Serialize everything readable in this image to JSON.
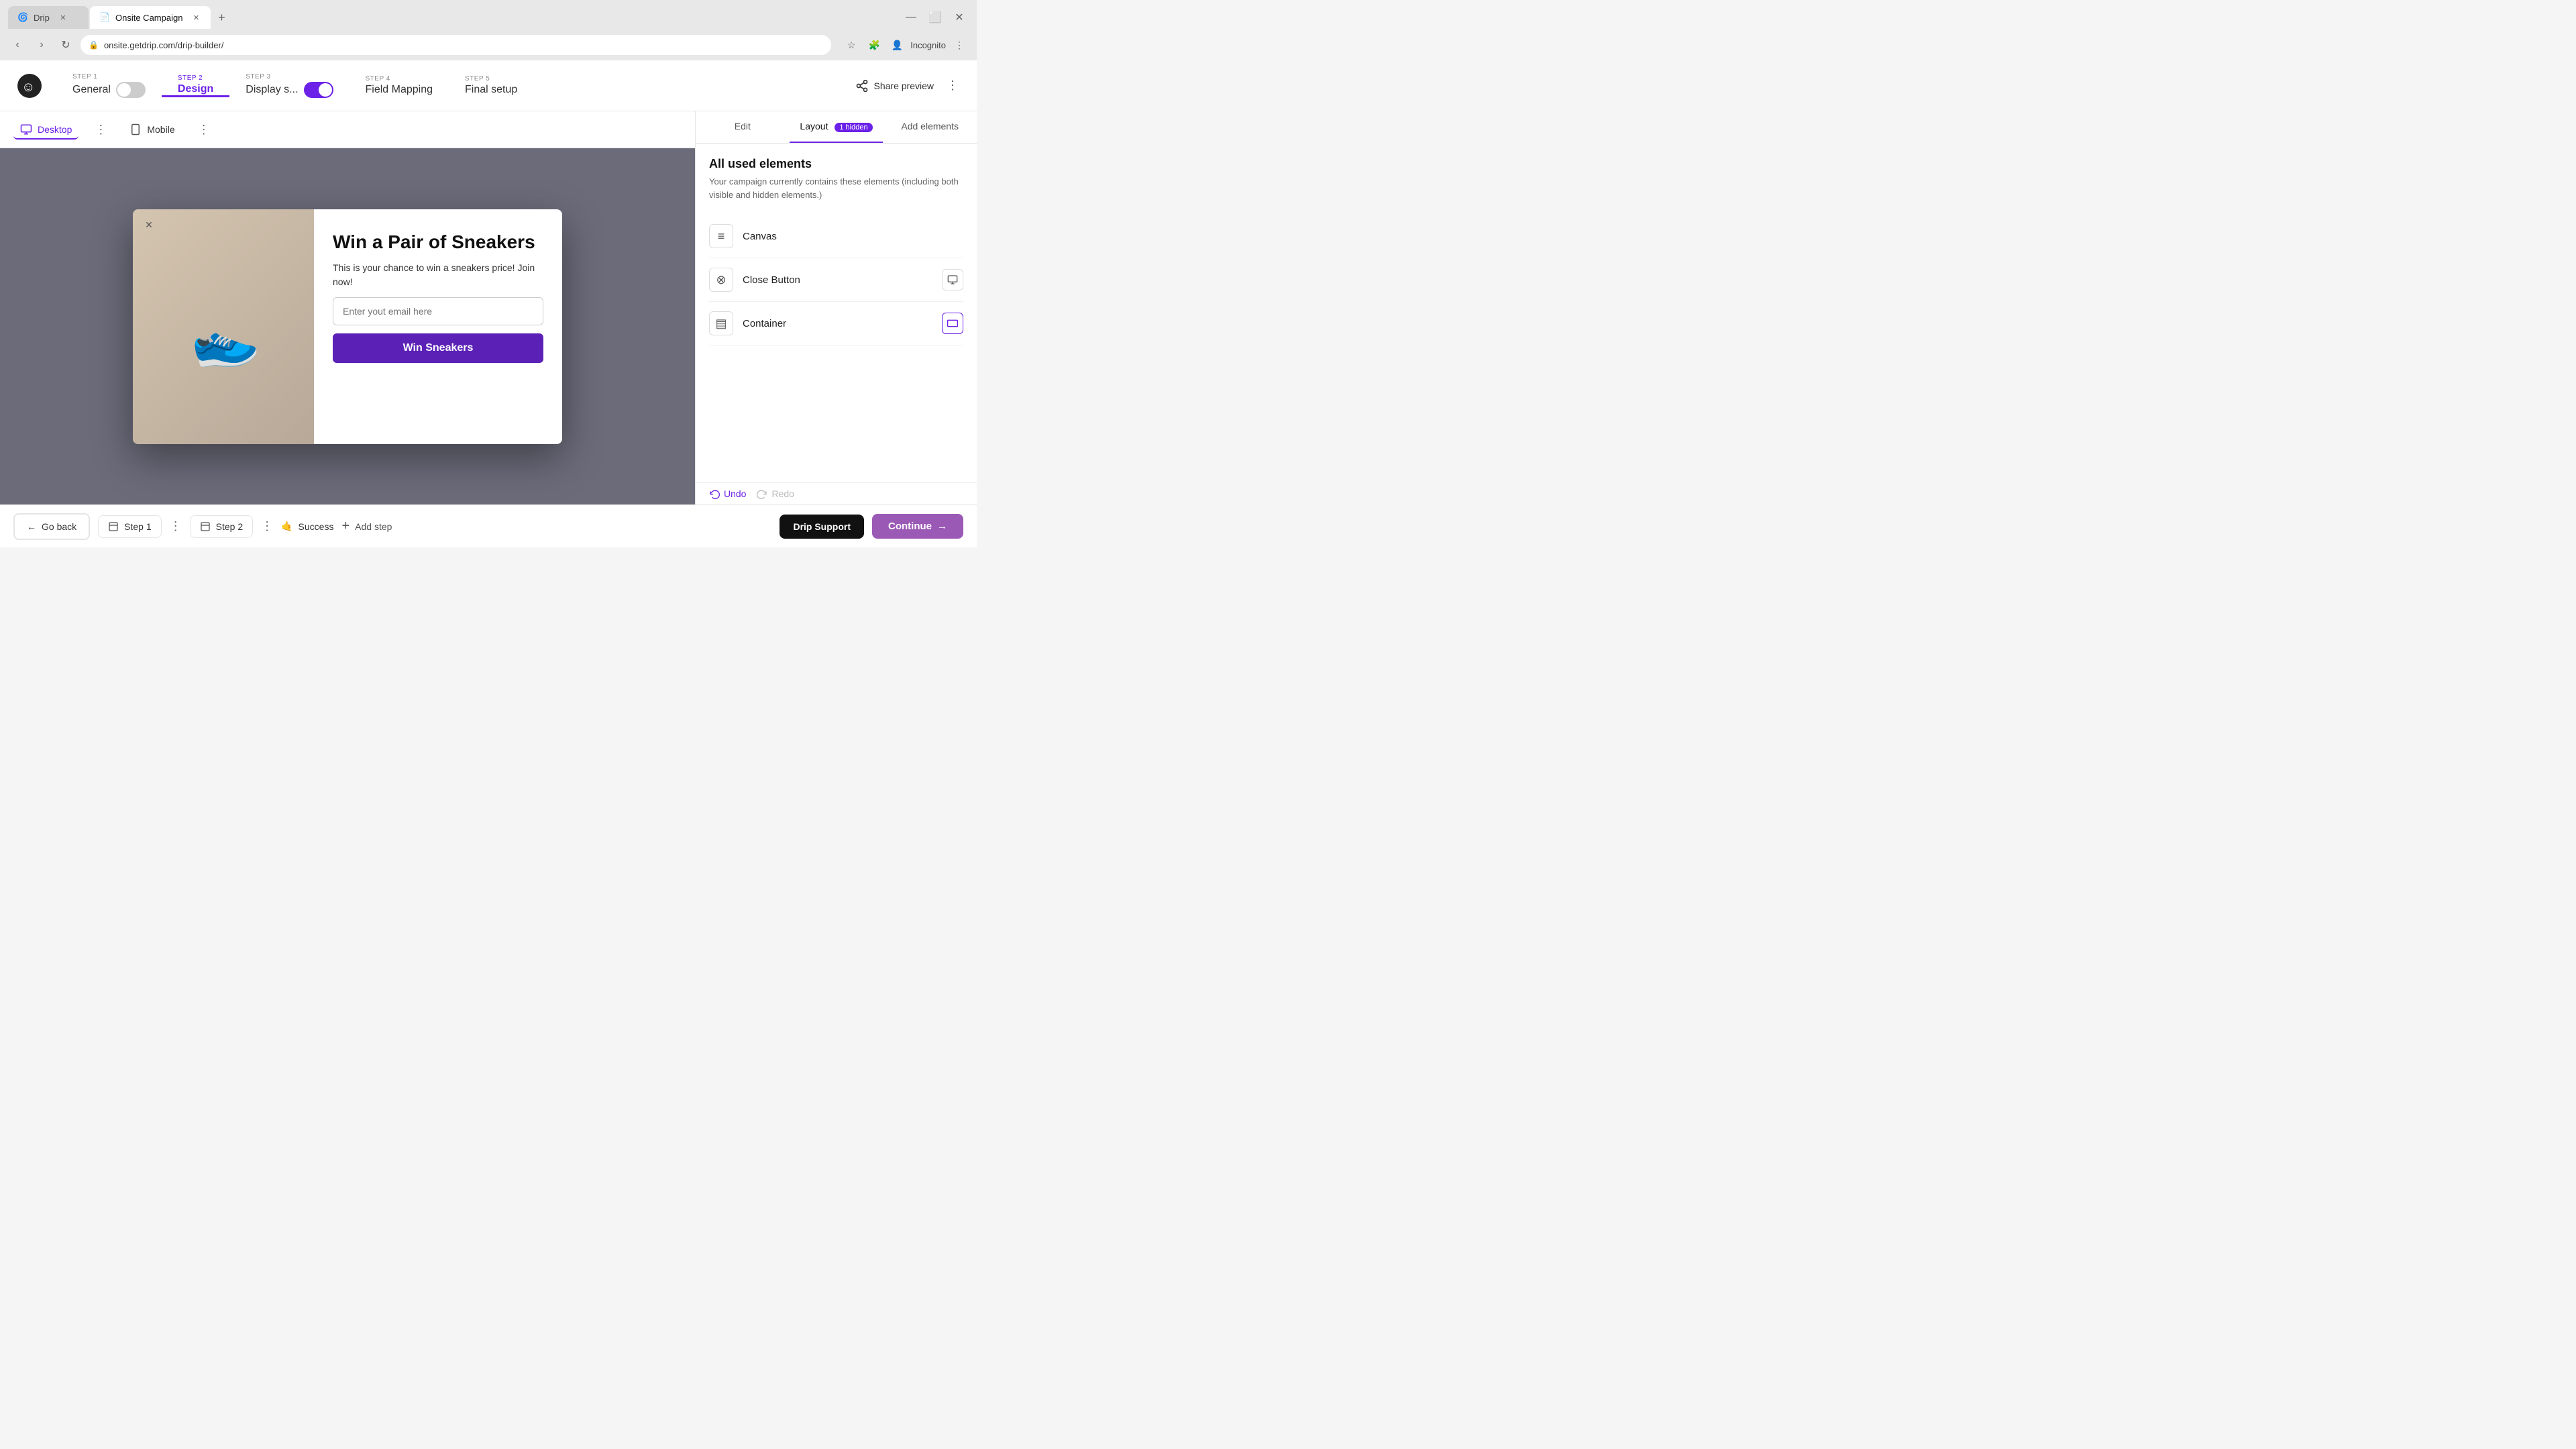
{
  "browser": {
    "tabs": [
      {
        "id": "drip",
        "favicon": "🌀",
        "label": "Drip",
        "active": false
      },
      {
        "id": "onsite",
        "favicon": "📄",
        "label": "Onsite Campaign",
        "active": true
      }
    ],
    "new_tab_label": "+",
    "address": "onsite.getdrip.com/drip-builder/",
    "lock_icon": "🔒",
    "profile_label": "Incognito"
  },
  "stepper": {
    "logo_alt": "Drip logo",
    "steps": [
      {
        "id": "general",
        "step_label": "STEP 1",
        "name": "General",
        "has_toggle": true,
        "active": false
      },
      {
        "id": "design",
        "step_label": "STEP 2",
        "name": "Design",
        "has_toggle": false,
        "active": true
      },
      {
        "id": "display",
        "step_label": "STEP 3",
        "name": "Display s...",
        "has_toggle": true,
        "active": false
      },
      {
        "id": "field_mapping",
        "step_label": "STEP 4",
        "name": "Field Mapping",
        "has_toggle": false,
        "active": false
      },
      {
        "id": "final_setup",
        "step_label": "STEP 5",
        "name": "Final setup",
        "has_toggle": false,
        "active": false
      }
    ],
    "share_preview_label": "Share preview",
    "more_icon": "⋮"
  },
  "canvas": {
    "desktop_label": "Desktop",
    "mobile_label": "Mobile",
    "more_icon": "⋮"
  },
  "modal": {
    "close_icon": "✕",
    "title": "Win a Pair of Sneakers",
    "description": "This is your chance to win a sneakers price! Join now!",
    "email_placeholder": "Enter yout email here",
    "cta_label": "Win Sneakers"
  },
  "right_panel": {
    "tabs": [
      {
        "id": "edit",
        "label": "Edit",
        "active": false
      },
      {
        "id": "layout",
        "label": "Layout",
        "badge": "1 hidden",
        "active": true
      },
      {
        "id": "add_elements",
        "label": "Add elements",
        "active": false
      }
    ],
    "section_title": "All used elements",
    "section_desc": "Your campaign currently contains these elements (including both visible and hidden elements.)",
    "elements": [
      {
        "id": "canvas",
        "icon": "≡",
        "label": "Canvas",
        "action_icon": ""
      },
      {
        "id": "close_button",
        "icon": "⊗",
        "label": "Close Button",
        "action_icon": "🖥"
      },
      {
        "id": "container",
        "icon": "▤",
        "label": "Container",
        "action_icon": "□"
      }
    ],
    "undo_label": "Undo",
    "redo_label": "Redo"
  },
  "bottom_bar": {
    "go_back_label": "Go back",
    "step1_label": "Step 1",
    "step2_label": "Step 2",
    "success_label": "Success",
    "add_step_label": "Add step",
    "drip_support_label": "Drip Support",
    "continue_label": "Continue"
  },
  "colors": {
    "accent": "#6b21e8",
    "cta_bg": "#5b21b6",
    "dark": "#111111",
    "support_bg": "#111111",
    "continue_bg": "#9b59b6"
  }
}
